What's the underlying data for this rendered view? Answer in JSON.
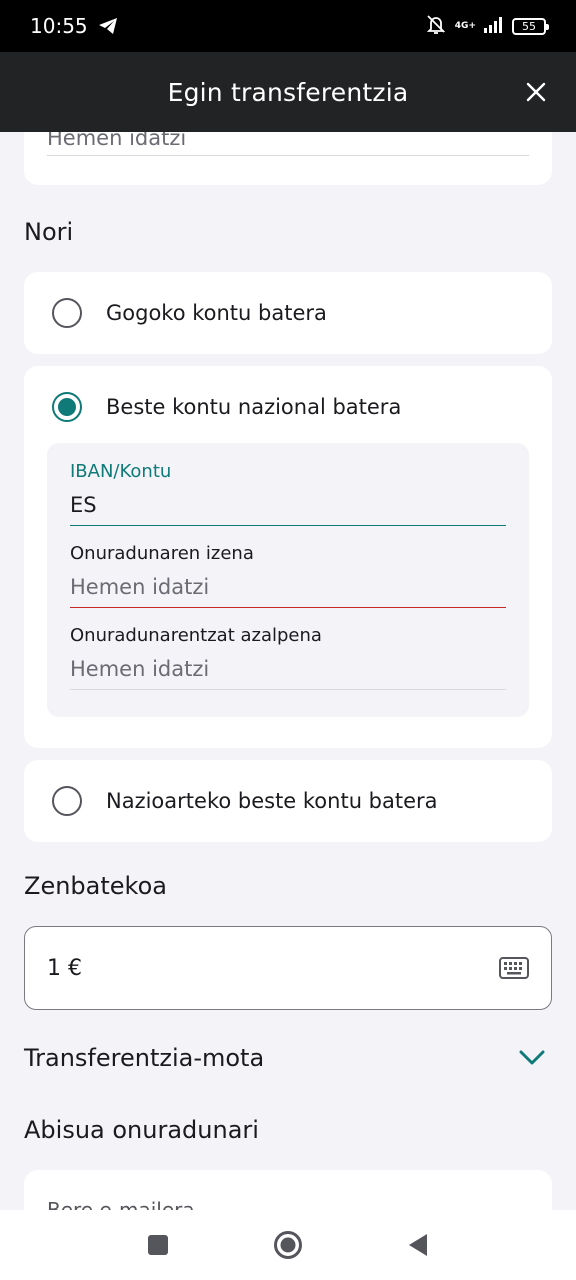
{
  "status_bar": {
    "time": "10:55",
    "network_top": "4G+",
    "battery": "55"
  },
  "header": {
    "title": "Egin transferentzia"
  },
  "top_card": {
    "placeholder": "Hemen idatzi"
  },
  "nori": {
    "title": "Nori",
    "options": [
      {
        "label": "Gogoko kontu batera",
        "selected": false
      },
      {
        "label": "Beste kontu nazional batera",
        "selected": true
      },
      {
        "label": "Nazioarteko beste kontu batera",
        "selected": false
      }
    ],
    "form": {
      "iban_label": "IBAN/Kontu",
      "iban_value": "ES",
      "name_label": "Onuradunaren izena",
      "name_placeholder": "Hemen idatzi",
      "desc_label": "Onuradunarentzat azalpena",
      "desc_placeholder": "Hemen idatzi"
    }
  },
  "amount": {
    "title": "Zenbatekoa",
    "value": "1  €"
  },
  "transfer_type": {
    "title": "Transferentzia-mota"
  },
  "notify": {
    "title": "Abisua onuradunari",
    "option": "Bere e-mailera"
  },
  "colors": {
    "accent": "#0f7a78",
    "error": "#c62828",
    "header_bg": "#222325",
    "page_bg": "#f4f4f8"
  }
}
